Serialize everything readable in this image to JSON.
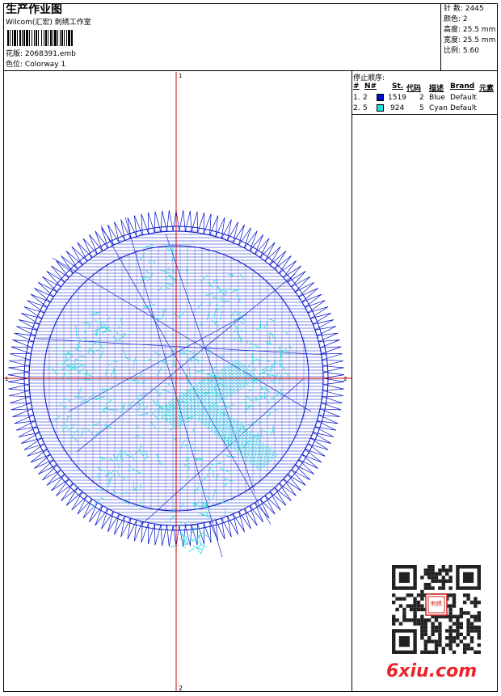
{
  "header": {
    "title": "生产作业图",
    "subtitle": "Wilcom(汇宏) 刺绣工作室",
    "design_label": "花版:",
    "design_value": "2068391.emb",
    "colorway_label": "色位:",
    "colorway_value": "Colorway 1"
  },
  "stats": [
    {
      "label": "针 数:",
      "value": "2445"
    },
    {
      "label": "颜色:",
      "value": "2"
    },
    {
      "label": "高度:",
      "value": "25.5 mm"
    },
    {
      "label": "宽度:",
      "value": "25.5 mm"
    },
    {
      "label": "比例:",
      "value": "5.60"
    }
  ],
  "stop_sequence": {
    "title": "停止顺序:",
    "headers": [
      "#",
      "N#",
      "St.",
      "代码",
      "描述",
      "Brand",
      "元素"
    ],
    "rows": [
      {
        "index": "1.",
        "needle": "2",
        "stitches": "1519",
        "code": "2",
        "description": "Blue",
        "brand": "Default",
        "color": "#0010c8"
      },
      {
        "index": "2.",
        "needle": "5",
        "stitches": "924",
        "code": "5",
        "description": "Cyan",
        "brand": "Default",
        "color": "#20e0e0"
      }
    ]
  },
  "axes": {
    "top": "1",
    "bottom": "2",
    "left": "1",
    "right": "2"
  },
  "colors": {
    "axis": "#d00000",
    "blue_thread": "#0010c8",
    "cyan_thread": "#20e0e0"
  },
  "watermark": {
    "text": "6xiu.com",
    "seal": "刺绣"
  }
}
